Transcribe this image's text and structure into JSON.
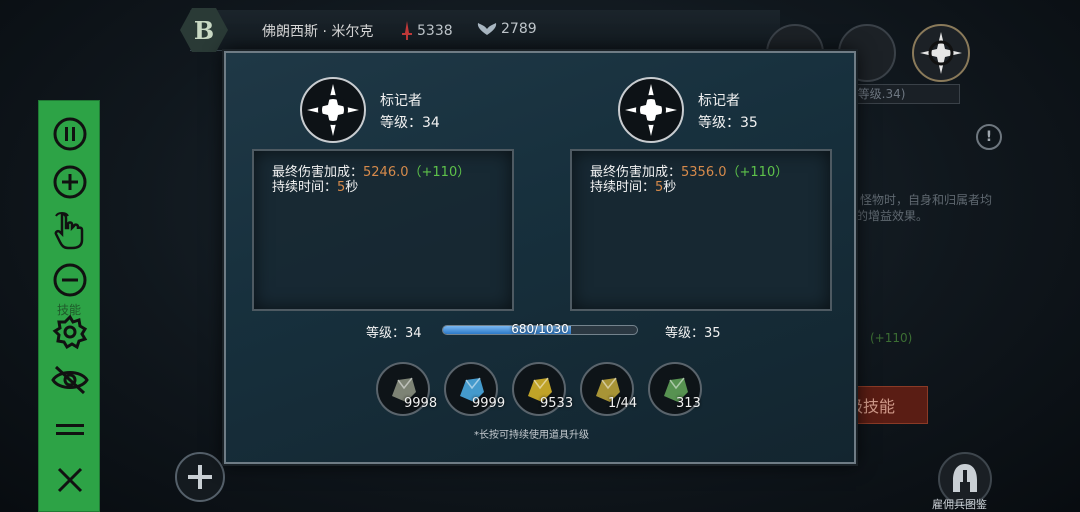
{
  "topbar": {
    "rank_letter": "B",
    "player_name": "佛朗西斯 · 米尔克",
    "attack_value": "5338",
    "defense_value": "2789"
  },
  "modal": {
    "current": {
      "name": "标记者",
      "level_label": "等级：34"
    },
    "next": {
      "name": "标记者",
      "level_label": "等级：35"
    },
    "current_desc": {
      "damage_label": "最终伤害加成：",
      "damage_value": "5246.0",
      "damage_bonus": "（+110）",
      "duration_label": "持续时间：",
      "duration_value": "5",
      "duration_unit": "秒"
    },
    "next_desc": {
      "damage_label": "最终伤害加成：",
      "damage_value": "5356.0",
      "damage_bonus": "（+110）",
      "duration_label": "持续时间：",
      "duration_value": "5",
      "duration_unit": "秒"
    },
    "progress": {
      "left_label": "等级：34",
      "right_label": "等级：35",
      "text": "680/1030",
      "fraction": 0.66
    },
    "items": [
      {
        "count": "9998",
        "color": "#8a8f80"
      },
      {
        "count": "9999",
        "color": "#4aa8e0"
      },
      {
        "count": "9533",
        "color": "#d4b22a"
      },
      {
        "count": "1/44",
        "color": "#b9a23a"
      },
      {
        "count": "313",
        "color": "#5fa058"
      }
    ],
    "hint": "*长按可持续使用道具升级"
  },
  "background": {
    "skill_tab": "标记者(等级.34)",
    "upgrade_button": "升级技能",
    "mercenary_label": "雇佣兵图鉴",
    "info_mark": "!",
    "desc_text_1": "怪物时，自身和归属者均",
    "desc_text_2": "的增益效果。",
    "bg_bonus": "(+110)"
  },
  "side_panel": {
    "color": "#2da346",
    "skill_label": "技能"
  }
}
